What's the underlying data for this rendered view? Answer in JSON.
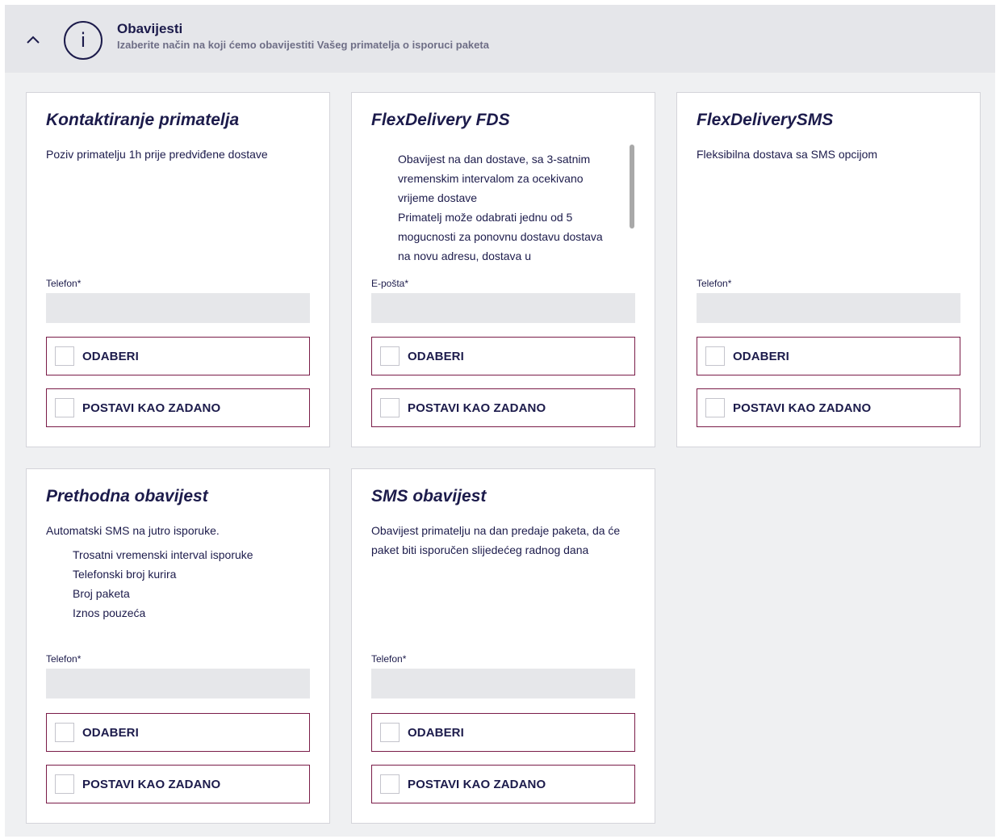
{
  "header": {
    "title": "Obavijesti",
    "subtitle": "Izaberite način na koji ćemo obavijestiti Vašeg primatelja o isporuci paketa",
    "info_glyph": "i",
    "toggle_icon": "chevron-up-icon"
  },
  "cards": [
    {
      "title": "Kontaktiranje primatelja",
      "description": "Poziv primatelju 1h prije predviđene dostave",
      "field_label": "Telefon*",
      "field_value": "",
      "select_label": "ODABERI",
      "default_label": "POSTAVI KAO ZADANO"
    },
    {
      "title": "FlexDelivery FDS",
      "description_lines": [
        "Obavijest na dan dostave, sa 3-satnim vremenskim intervalom za ocekivano vrijeme dostave",
        "Primatelj može odabrati jednu od 5 mogucnosti za ponovnu dostavu dostava na novu adresu, dostava u"
      ],
      "field_label": "E-pošta*",
      "field_value": "",
      "select_label": "ODABERI",
      "default_label": "POSTAVI KAO ZADANO"
    },
    {
      "title": "FlexDeliverySMS",
      "description": "Fleksibilna dostava sa SMS opcijom",
      "field_label": "Telefon*",
      "field_value": "",
      "select_label": "ODABERI",
      "default_label": "POSTAVI KAO ZADANO"
    },
    {
      "title": "Prethodna obavijest",
      "description": "Automatski SMS na jutro isporuke.",
      "list": [
        "Trosatni vremenski interval isporuke",
        "Telefonski broj kurira",
        "Broj paketa",
        "Iznos pouzeća"
      ],
      "field_label": "Telefon*",
      "field_value": "",
      "select_label": "ODABERI",
      "default_label": "POSTAVI KAO ZADANO"
    },
    {
      "title": "SMS obavijest",
      "description": "Obavijest primatelju na dan predaje paketa, da će paket biti isporučen slijedećeg radnog dana",
      "field_label": "Telefon*",
      "field_value": "",
      "select_label": "ODABERI",
      "default_label": "POSTAVI KAO ZADANO"
    }
  ]
}
